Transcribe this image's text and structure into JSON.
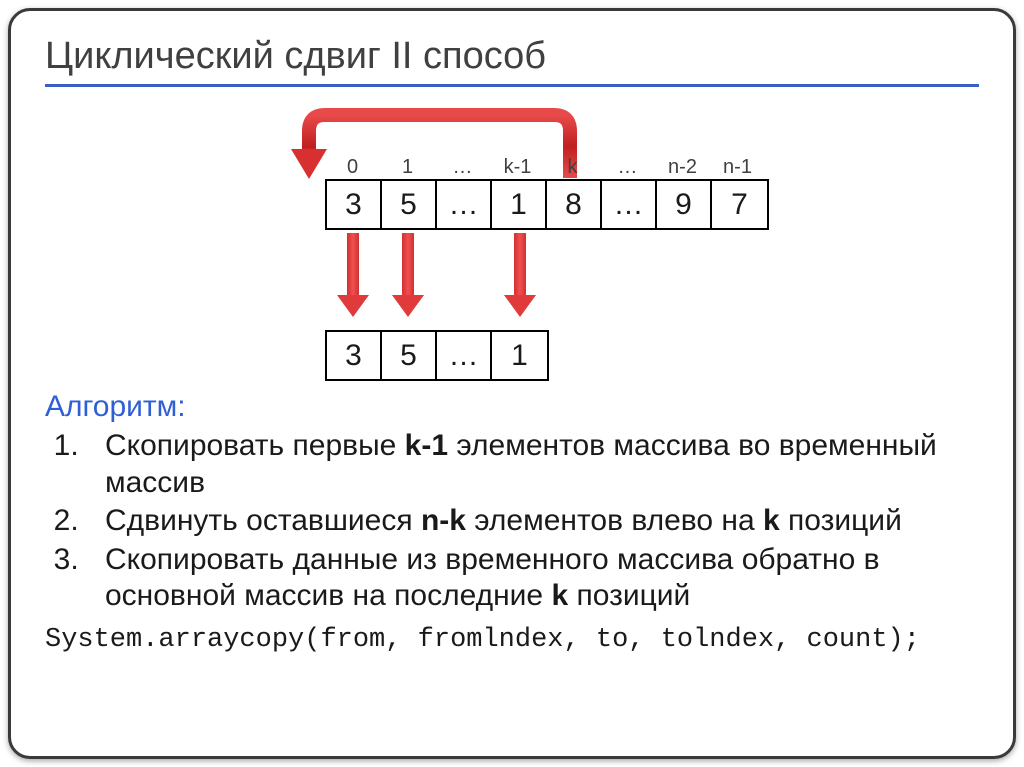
{
  "title": "Циклический сдвиг II способ",
  "index_labels": [
    "0",
    "1",
    "…",
    "k-1",
    "k",
    "…",
    "n-2",
    "n-1"
  ],
  "array_top": [
    "3",
    "5",
    "…",
    "1",
    "8",
    "…",
    "9",
    "7"
  ],
  "array_bottom": [
    "3",
    "5",
    "…",
    "1"
  ],
  "algorithm_heading": "Алгоритм:",
  "steps": {
    "s1": "Скопировать первые <b>k-1</b> элементов массива во временный массив",
    "s2": "Сдвинуть оставшиеся <b>n-k</b> элементов влево на <b>k</b> позиций",
    "s3": "Скопировать данные из временного массива обратно в основной массив на последние <b>k</b> позиций"
  },
  "code": "System.arraycopy(from, fromlndex, to, tolndex, count);"
}
